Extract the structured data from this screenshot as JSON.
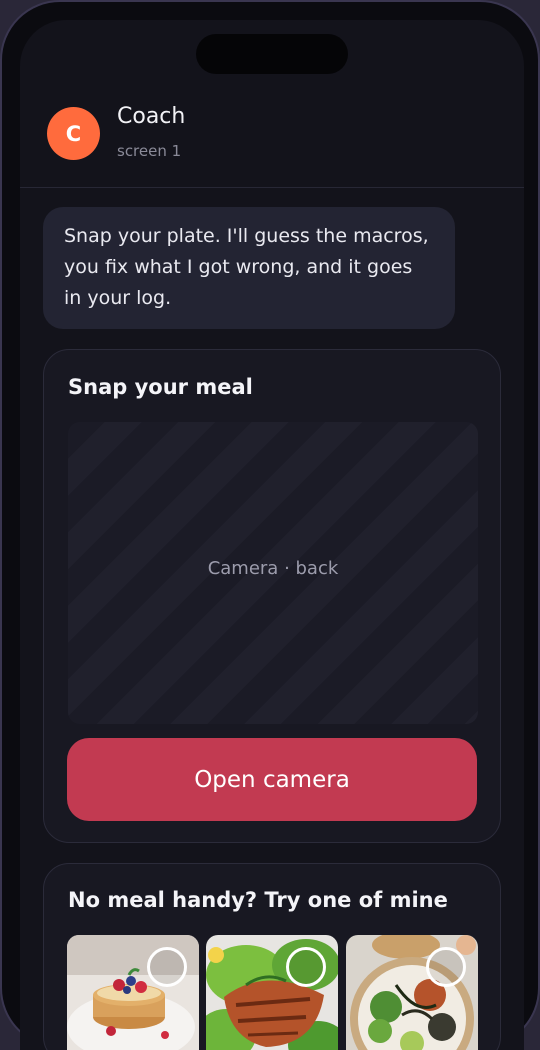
{
  "header": {
    "avatar_initial": "C",
    "title": "Coach",
    "subtitle": "screen 1"
  },
  "message": {
    "text": "Snap your plate. I'll guess the macros, you fix what I got wrong, and it goes in your log."
  },
  "snap_card": {
    "title": "Snap your meal",
    "viewfinder_label": "Camera · back",
    "button_label": "Open camera"
  },
  "samples_card": {
    "title": "No meal handy? Try one of mine",
    "items": [
      {
        "icon": "pancakes-photo"
      },
      {
        "icon": "salmon-salad-photo"
      },
      {
        "icon": "poke-bowl-photo"
      }
    ]
  },
  "colors": {
    "accent": "#c23a51",
    "avatar": "#ff6b3d",
    "background": "#13131b"
  }
}
